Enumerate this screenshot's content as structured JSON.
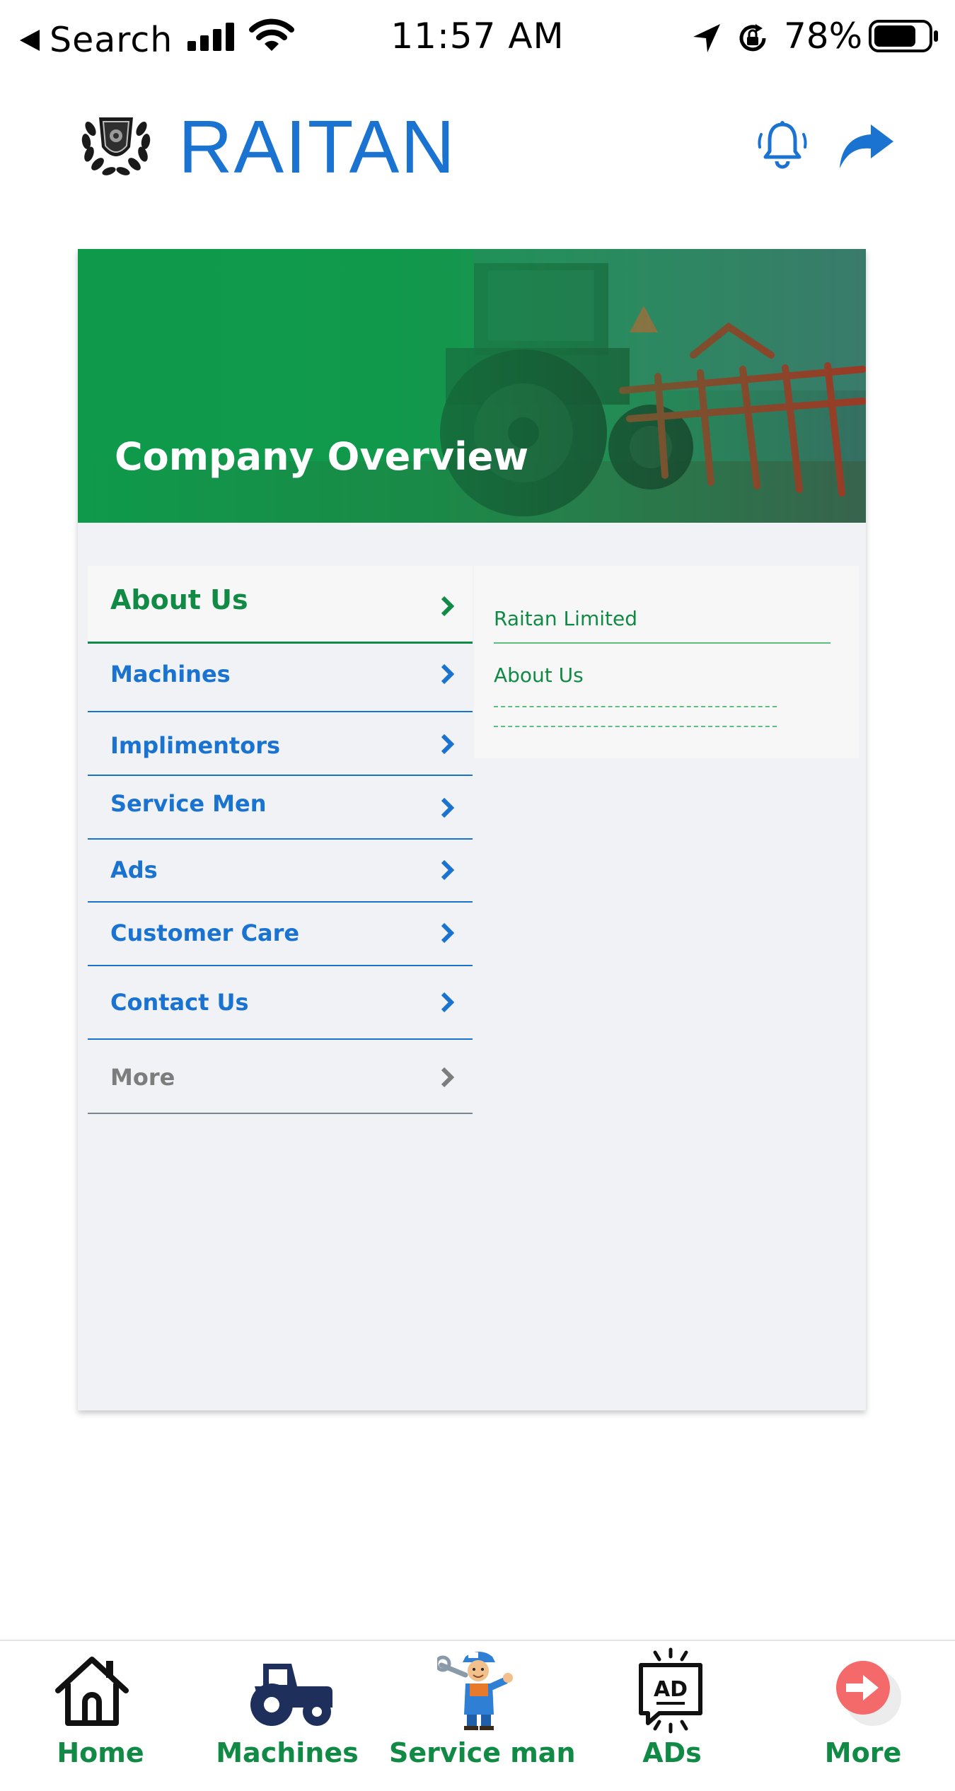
{
  "status_bar": {
    "back_label": "Search",
    "time": "11:57 AM",
    "battery_percent": "78%",
    "battery_level": 0.78
  },
  "header": {
    "title": "RAITAN",
    "logo_icon": "wreath-shield-logo",
    "notification_icon": "bell-icon",
    "share_icon": "share-arrow-icon"
  },
  "banner": {
    "title": "Company Overview"
  },
  "menu": {
    "items": [
      {
        "label": "About Us",
        "active": true
      },
      {
        "label": "Machines"
      },
      {
        "label": "Implimentors"
      },
      {
        "label": "Service Men"
      },
      {
        "label": "Ads"
      },
      {
        "label": "Customer Care"
      },
      {
        "label": "Contact Us"
      },
      {
        "label": "More",
        "muted": true
      }
    ]
  },
  "submenu": {
    "items": [
      "Raitan Limited",
      "About Us"
    ]
  },
  "bottom_nav": {
    "items": [
      {
        "label": "Home",
        "icon": "home-icon"
      },
      {
        "label": "Machines",
        "icon": "tractor-icon"
      },
      {
        "label": "Service man",
        "icon": "mechanic-icon"
      },
      {
        "label": "ADs",
        "icon": "ad-board-icon"
      },
      {
        "label": "More",
        "icon": "arrow-circle-icon"
      }
    ]
  },
  "colors": {
    "brand_blue": "#1a73d0",
    "brand_green": "#108a45",
    "banner_green": "#0f9a4b",
    "muted_gray": "#7d7d7d",
    "card_bg": "#f0f2f5"
  }
}
